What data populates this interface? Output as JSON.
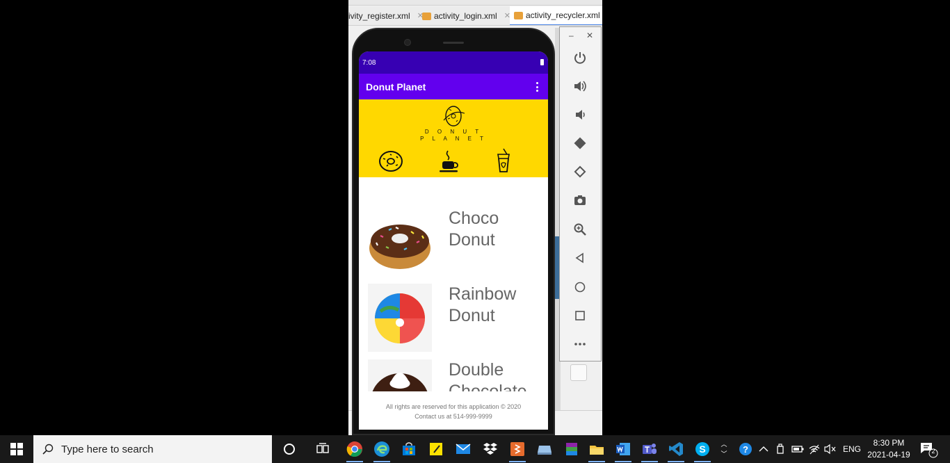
{
  "ide": {
    "tabs": [
      {
        "label": "ivity_register.xml"
      },
      {
        "label": "activity_login.xml"
      },
      {
        "label": "activity_recycler.xml"
      }
    ]
  },
  "phone": {
    "status_time": "7:08",
    "app_title": "Donut Planet",
    "logo_text_line1": "D O N U T",
    "logo_text_line2": "P L A N E T",
    "items": [
      {
        "name": "Choco Donut"
      },
      {
        "name": "Rainbow Donut"
      },
      {
        "name": "Double Chocolate"
      }
    ],
    "footer_line1": "All rights are reserved for this application © 2020",
    "footer_line2": "Contact us at 514-999-9999"
  },
  "emulator": {
    "buttons": [
      "power-icon",
      "volume-up-icon",
      "volume-down-icon",
      "rotate-left-icon",
      "rotate-right-icon",
      "camera-icon",
      "zoom-icon",
      "back-icon",
      "home-icon",
      "overview-icon",
      "more-icon"
    ]
  },
  "taskbar": {
    "search_placeholder": "Type here to search",
    "language": "ENG",
    "time": "8:30 PM",
    "date": "2021-04-19",
    "notification_count": "2"
  },
  "colors": {
    "status_bar": "#3700b3",
    "app_bar": "#6200ee",
    "banner": "#ffd800"
  }
}
